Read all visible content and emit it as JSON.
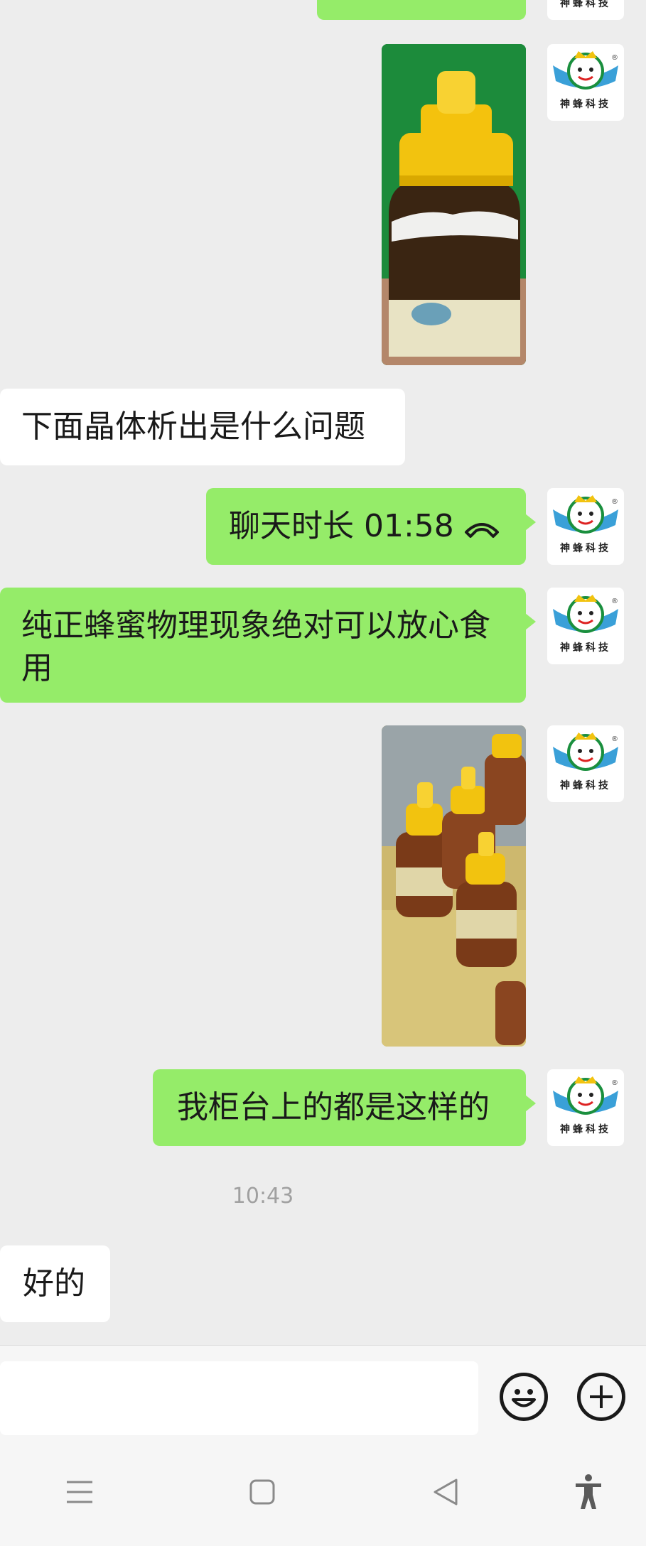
{
  "messages": [
    {
      "side": "right",
      "type": "image",
      "description": "honey-jar-crystallized"
    },
    {
      "side": "left",
      "type": "text",
      "text": "下面晶体析出是什么问题"
    },
    {
      "side": "right",
      "type": "call",
      "text": "聊天时长 01:58"
    },
    {
      "side": "right",
      "type": "text",
      "text": "纯正蜂蜜物理现象绝对可以放心食用"
    },
    {
      "side": "right",
      "type": "image",
      "description": "honey-bottles-on-counter"
    },
    {
      "side": "right",
      "type": "text",
      "text": "我柜台上的都是这样的"
    },
    {
      "side": "left",
      "type": "text",
      "text": "好的"
    }
  ],
  "timestamp": "10:43",
  "avatar": {
    "brand_text": "神蜂科技",
    "registered_mark": "®"
  },
  "icons": {
    "call_end": "phone-hangup-icon",
    "emoji": "emoji-icon",
    "plus": "plus-icon",
    "nav_menu": "menu-icon",
    "nav_home": "home-icon",
    "nav_back": "back-icon",
    "nav_accessibility": "accessibility-icon"
  },
  "colors": {
    "sent_bubble": "#95ec69",
    "received_bubble": "#ffffff",
    "background": "#ededed"
  }
}
